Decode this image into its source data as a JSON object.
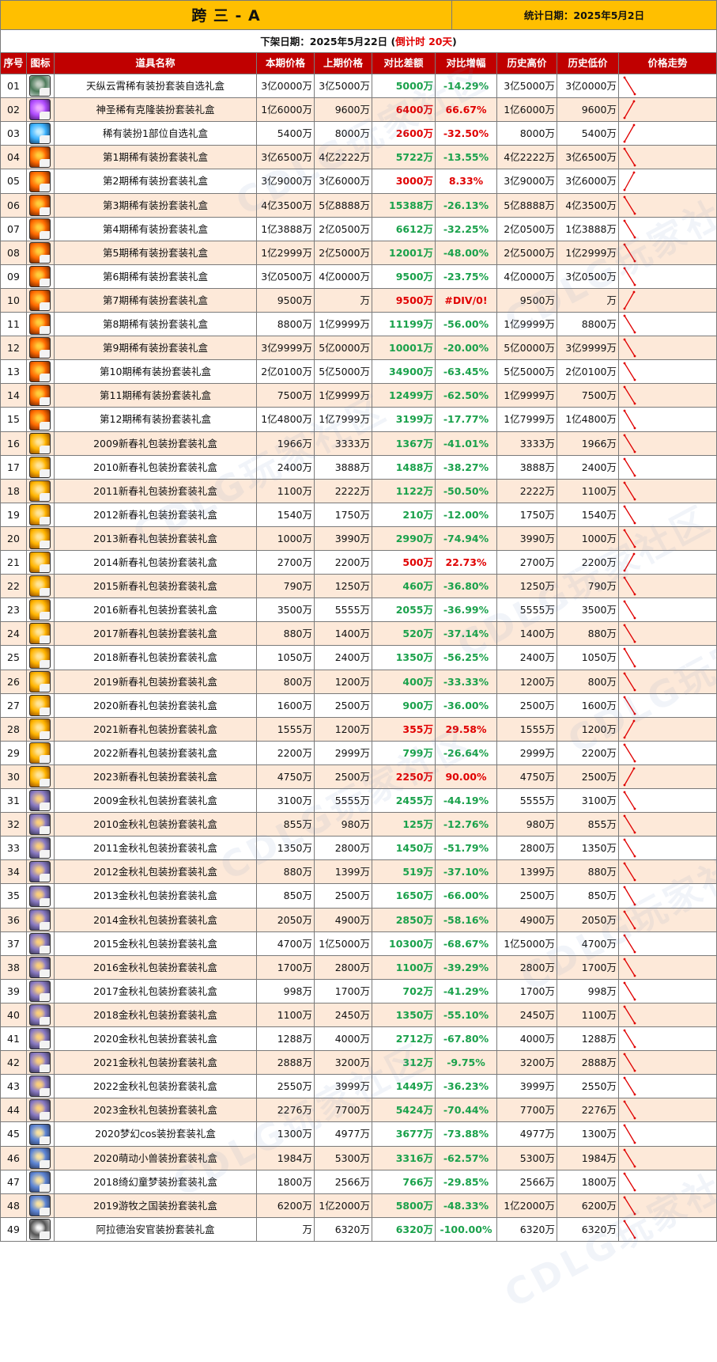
{
  "header": {
    "title": "跨 三 - A",
    "stat_date": "统计日期：2025年5月2日",
    "removal_prefix": "下架日期：2025年5月22日 (",
    "removal_countdown": "倒计时 20天",
    "removal_suffix": ")"
  },
  "columns": [
    "序号",
    "图标",
    "道具名称",
    "本期价格",
    "上期价格",
    "对比差额",
    "对比增幅",
    "历史高价",
    "历史低价",
    "价格走势"
  ],
  "colors": {
    "title_bg": "#ffbf00",
    "header_bg": "#c00000",
    "row_alt_bg": "#fde9d9",
    "increase_red": "#e00000",
    "decrease_green": "#1aa14b",
    "trend_line": "#e00000"
  },
  "watermark": "CDLG玩家社区",
  "rows": [
    {
      "no": "01",
      "name": "天纵云霄稀有装扮套装自选礼盒",
      "cur": "3亿0000万",
      "prev": "3亿5000万",
      "diff": "5000万",
      "pct": "-14.29%",
      "high": "3亿5000万",
      "low": "3亿0000万",
      "dir": "down",
      "icon": "ornate-green"
    },
    {
      "no": "02",
      "name": "神圣稀有克隆装扮套装礼盒",
      "cur": "1亿6000万",
      "prev": "9600万",
      "diff": "6400万",
      "pct": "66.67%",
      "high": "1亿6000万",
      "low": "9600万",
      "dir": "up",
      "icon": "purple-orb"
    },
    {
      "no": "03",
      "name": "稀有装扮1部位自选礼盒",
      "cur": "5400万",
      "prev": "8000万",
      "diff": "2600万",
      "pct": "-32.50%",
      "high": "8000万",
      "low": "5400万",
      "dir": "up",
      "icon": "blue-orb"
    },
    {
      "no": "04",
      "name": "第1期稀有装扮套装礼盒",
      "cur": "3亿6500万",
      "prev": "4亿2222万",
      "diff": "5722万",
      "pct": "-13.55%",
      "high": "4亿2222万",
      "low": "3亿6500万",
      "dir": "down",
      "icon": "fire-box"
    },
    {
      "no": "05",
      "name": "第2期稀有装扮套装礼盒",
      "cur": "3亿9000万",
      "prev": "3亿6000万",
      "diff": "3000万",
      "pct": "8.33%",
      "high": "3亿9000万",
      "low": "3亿6000万",
      "dir": "up",
      "icon": "fire-box"
    },
    {
      "no": "06",
      "name": "第3期稀有装扮套装礼盒",
      "cur": "4亿3500万",
      "prev": "5亿8888万",
      "diff": "15388万",
      "pct": "-26.13%",
      "high": "5亿8888万",
      "low": "4亿3500万",
      "dir": "down",
      "icon": "fire-box"
    },
    {
      "no": "07",
      "name": "第4期稀有装扮套装礼盒",
      "cur": "1亿3888万",
      "prev": "2亿0500万",
      "diff": "6612万",
      "pct": "-32.25%",
      "high": "2亿0500万",
      "low": "1亿3888万",
      "dir": "down",
      "icon": "fire-box"
    },
    {
      "no": "08",
      "name": "第5期稀有装扮套装礼盒",
      "cur": "1亿2999万",
      "prev": "2亿5000万",
      "diff": "12001万",
      "pct": "-48.00%",
      "high": "2亿5000万",
      "low": "1亿2999万",
      "dir": "down",
      "icon": "fire-box"
    },
    {
      "no": "09",
      "name": "第6期稀有装扮套装礼盒",
      "cur": "3亿0500万",
      "prev": "4亿0000万",
      "diff": "9500万",
      "pct": "-23.75%",
      "high": "4亿0000万",
      "low": "3亿0500万",
      "dir": "down",
      "icon": "fire-box"
    },
    {
      "no": "10",
      "name": "第7期稀有装扮套装礼盒",
      "cur": "9500万",
      "prev": "万",
      "diff": "9500万",
      "pct": "#DIV/0!",
      "high": "9500万",
      "low": "万",
      "dir": "up",
      "icon": "fire-box"
    },
    {
      "no": "11",
      "name": "第8期稀有装扮套装礼盒",
      "cur": "8800万",
      "prev": "1亿9999万",
      "diff": "11199万",
      "pct": "-56.00%",
      "high": "1亿9999万",
      "low": "8800万",
      "dir": "down",
      "icon": "fire-box"
    },
    {
      "no": "12",
      "name": "第9期稀有装扮套装礼盒",
      "cur": "3亿9999万",
      "prev": "5亿0000万",
      "diff": "10001万",
      "pct": "-20.00%",
      "high": "5亿0000万",
      "low": "3亿9999万",
      "dir": "down",
      "icon": "fire-box"
    },
    {
      "no": "13",
      "name": "第10期稀有装扮套装礼盒",
      "cur": "2亿0100万",
      "prev": "5亿5000万",
      "diff": "34900万",
      "pct": "-63.45%",
      "high": "5亿5000万",
      "low": "2亿0100万",
      "dir": "down",
      "icon": "fire-box"
    },
    {
      "no": "14",
      "name": "第11期稀有装扮套装礼盒",
      "cur": "7500万",
      "prev": "1亿9999万",
      "diff": "12499万",
      "pct": "-62.50%",
      "high": "1亿9999万",
      "low": "7500万",
      "dir": "down",
      "icon": "fire-box"
    },
    {
      "no": "15",
      "name": "第12期稀有装扮套装礼盒",
      "cur": "1亿4800万",
      "prev": "1亿7999万",
      "diff": "3199万",
      "pct": "-17.77%",
      "high": "1亿7999万",
      "low": "1亿4800万",
      "dir": "down",
      "icon": "fire-box"
    },
    {
      "no": "16",
      "name": "2009新春礼包装扮套装礼盒",
      "cur": "1966万",
      "prev": "3333万",
      "diff": "1367万",
      "pct": "-41.01%",
      "high": "3333万",
      "low": "1966万",
      "dir": "down",
      "icon": "gold-bag"
    },
    {
      "no": "17",
      "name": "2010新春礼包装扮套装礼盒",
      "cur": "2400万",
      "prev": "3888万",
      "diff": "1488万",
      "pct": "-38.27%",
      "high": "3888万",
      "low": "2400万",
      "dir": "down",
      "icon": "gold-bag"
    },
    {
      "no": "18",
      "name": "2011新春礼包装扮套装礼盒",
      "cur": "1100万",
      "prev": "2222万",
      "diff": "1122万",
      "pct": "-50.50%",
      "high": "2222万",
      "low": "1100万",
      "dir": "down",
      "icon": "gold-bag"
    },
    {
      "no": "19",
      "name": "2012新春礼包装扮套装礼盒",
      "cur": "1540万",
      "prev": "1750万",
      "diff": "210万",
      "pct": "-12.00%",
      "high": "1750万",
      "low": "1540万",
      "dir": "down",
      "icon": "gold-bag"
    },
    {
      "no": "20",
      "name": "2013新春礼包装扮套装礼盒",
      "cur": "1000万",
      "prev": "3990万",
      "diff": "2990万",
      "pct": "-74.94%",
      "high": "3990万",
      "low": "1000万",
      "dir": "down",
      "icon": "gold-bag"
    },
    {
      "no": "21",
      "name": "2014新春礼包装扮套装礼盒",
      "cur": "2700万",
      "prev": "2200万",
      "diff": "500万",
      "pct": "22.73%",
      "high": "2700万",
      "low": "2200万",
      "dir": "up",
      "icon": "gold-bag"
    },
    {
      "no": "22",
      "name": "2015新春礼包装扮套装礼盒",
      "cur": "790万",
      "prev": "1250万",
      "diff": "460万",
      "pct": "-36.80%",
      "high": "1250万",
      "low": "790万",
      "dir": "down",
      "icon": "gold-bag"
    },
    {
      "no": "23",
      "name": "2016新春礼包装扮套装礼盒",
      "cur": "3500万",
      "prev": "5555万",
      "diff": "2055万",
      "pct": "-36.99%",
      "high": "5555万",
      "low": "3500万",
      "dir": "down",
      "icon": "gold-bag"
    },
    {
      "no": "24",
      "name": "2017新春礼包装扮套装礼盒",
      "cur": "880万",
      "prev": "1400万",
      "diff": "520万",
      "pct": "-37.14%",
      "high": "1400万",
      "low": "880万",
      "dir": "down",
      "icon": "gold-bag"
    },
    {
      "no": "25",
      "name": "2018新春礼包装扮套装礼盒",
      "cur": "1050万",
      "prev": "2400万",
      "diff": "1350万",
      "pct": "-56.25%",
      "high": "2400万",
      "low": "1050万",
      "dir": "down",
      "icon": "gold-bag"
    },
    {
      "no": "26",
      "name": "2019新春礼包装扮套装礼盒",
      "cur": "800万",
      "prev": "1200万",
      "diff": "400万",
      "pct": "-33.33%",
      "high": "1200万",
      "low": "800万",
      "dir": "down",
      "icon": "gold-bag"
    },
    {
      "no": "27",
      "name": "2020新春礼包装扮套装礼盒",
      "cur": "1600万",
      "prev": "2500万",
      "diff": "900万",
      "pct": "-36.00%",
      "high": "2500万",
      "low": "1600万",
      "dir": "down",
      "icon": "gold-bag"
    },
    {
      "no": "28",
      "name": "2021新春礼包装扮套装礼盒",
      "cur": "1555万",
      "prev": "1200万",
      "diff": "355万",
      "pct": "29.58%",
      "high": "1555万",
      "low": "1200万",
      "dir": "up",
      "icon": "gold-bag"
    },
    {
      "no": "29",
      "name": "2022新春礼包装扮套装礼盒",
      "cur": "2200万",
      "prev": "2999万",
      "diff": "799万",
      "pct": "-26.64%",
      "high": "2999万",
      "low": "2200万",
      "dir": "down",
      "icon": "gold-bag"
    },
    {
      "no": "30",
      "name": "2023新春礼包装扮套装礼盒",
      "cur": "4750万",
      "prev": "2500万",
      "diff": "2250万",
      "pct": "90.00%",
      "high": "4750万",
      "low": "2500万",
      "dir": "up",
      "icon": "gold-bag"
    },
    {
      "no": "31",
      "name": "2009金秋礼包装扮套装礼盒",
      "cur": "3100万",
      "prev": "5555万",
      "diff": "2455万",
      "pct": "-44.19%",
      "high": "5555万",
      "low": "3100万",
      "dir": "down",
      "icon": "autumn-2009"
    },
    {
      "no": "32",
      "name": "2010金秋礼包装扮套装礼盒",
      "cur": "855万",
      "prev": "980万",
      "diff": "125万",
      "pct": "-12.76%",
      "high": "980万",
      "low": "855万",
      "dir": "down",
      "icon": "autumn-2010"
    },
    {
      "no": "33",
      "name": "2011金秋礼包装扮套装礼盒",
      "cur": "1350万",
      "prev": "2800万",
      "diff": "1450万",
      "pct": "-51.79%",
      "high": "2800万",
      "low": "1350万",
      "dir": "down",
      "icon": "autumn-2011"
    },
    {
      "no": "34",
      "name": "2012金秋礼包装扮套装礼盒",
      "cur": "880万",
      "prev": "1399万",
      "diff": "519万",
      "pct": "-37.10%",
      "high": "1399万",
      "low": "880万",
      "dir": "down",
      "icon": "autumn-2012"
    },
    {
      "no": "35",
      "name": "2013金秋礼包装扮套装礼盒",
      "cur": "850万",
      "prev": "2500万",
      "diff": "1650万",
      "pct": "-66.00%",
      "high": "2500万",
      "low": "850万",
      "dir": "down",
      "icon": "autumn-2013"
    },
    {
      "no": "36",
      "name": "2014金秋礼包装扮套装礼盒",
      "cur": "2050万",
      "prev": "4900万",
      "diff": "2850万",
      "pct": "-58.16%",
      "high": "4900万",
      "low": "2050万",
      "dir": "down",
      "icon": "autumn-2014"
    },
    {
      "no": "37",
      "name": "2015金秋礼包装扮套装礼盒",
      "cur": "4700万",
      "prev": "1亿5000万",
      "diff": "10300万",
      "pct": "-68.67%",
      "high": "1亿5000万",
      "low": "4700万",
      "dir": "down",
      "icon": "autumn-2015"
    },
    {
      "no": "38",
      "name": "2016金秋礼包装扮套装礼盒",
      "cur": "1700万",
      "prev": "2800万",
      "diff": "1100万",
      "pct": "-39.29%",
      "high": "2800万",
      "low": "1700万",
      "dir": "down",
      "icon": "autumn-2016"
    },
    {
      "no": "39",
      "name": "2017金秋礼包装扮套装礼盒",
      "cur": "998万",
      "prev": "1700万",
      "diff": "702万",
      "pct": "-41.29%",
      "high": "1700万",
      "low": "998万",
      "dir": "down",
      "icon": "autumn-2017"
    },
    {
      "no": "40",
      "name": "2018金秋礼包装扮套装礼盒",
      "cur": "1100万",
      "prev": "2450万",
      "diff": "1350万",
      "pct": "-55.10%",
      "high": "2450万",
      "low": "1100万",
      "dir": "down",
      "icon": "autumn-2018"
    },
    {
      "no": "41",
      "name": "2020金秋礼包装扮套装礼盒",
      "cur": "1288万",
      "prev": "4000万",
      "diff": "2712万",
      "pct": "-67.80%",
      "high": "4000万",
      "low": "1288万",
      "dir": "down",
      "icon": "autumn-2020"
    },
    {
      "no": "42",
      "name": "2021金秋礼包装扮套装礼盒",
      "cur": "2888万",
      "prev": "3200万",
      "diff": "312万",
      "pct": "-9.75%",
      "high": "3200万",
      "low": "2888万",
      "dir": "down",
      "icon": "autumn-2021"
    },
    {
      "no": "43",
      "name": "2022金秋礼包装扮套装礼盒",
      "cur": "2550万",
      "prev": "3999万",
      "diff": "1449万",
      "pct": "-36.23%",
      "high": "3999万",
      "low": "2550万",
      "dir": "down",
      "icon": "autumn-2022"
    },
    {
      "no": "44",
      "name": "2023金秋礼包装扮套装礼盒",
      "cur": "2276万",
      "prev": "7700万",
      "diff": "5424万",
      "pct": "-70.44%",
      "high": "7700万",
      "low": "2276万",
      "dir": "down",
      "icon": "autumn-2023"
    },
    {
      "no": "45",
      "name": "2020梦幻cos装扮套装礼盒",
      "cur": "1300万",
      "prev": "4977万",
      "diff": "3677万",
      "pct": "-73.88%",
      "high": "4977万",
      "low": "1300万",
      "dir": "down",
      "icon": "dream-2020"
    },
    {
      "no": "46",
      "name": "2020萌动小兽装扮套装礼盒",
      "cur": "1984万",
      "prev": "5300万",
      "diff": "3316万",
      "pct": "-62.57%",
      "high": "5300万",
      "low": "1984万",
      "dir": "down",
      "icon": "beast-2020"
    },
    {
      "no": "47",
      "name": "2018绮幻童梦装扮套装礼盒",
      "cur": "1800万",
      "prev": "2566万",
      "diff": "766万",
      "pct": "-29.85%",
      "high": "2566万",
      "low": "1800万",
      "dir": "down",
      "icon": "child-2018"
    },
    {
      "no": "48",
      "name": "2019游牧之国装扮套装礼盒",
      "cur": "6200万",
      "prev": "1亿2000万",
      "diff": "5800万",
      "pct": "-48.33%",
      "high": "1亿2000万",
      "low": "6200万",
      "dir": "down",
      "icon": "nomad-2019"
    },
    {
      "no": "49",
      "name": "阿拉德治安官装扮套装礼盒",
      "cur": "万",
      "prev": "6320万",
      "diff": "6320万",
      "pct": "-100.00%",
      "high": "6320万",
      "low": "6320万",
      "dir": "down",
      "icon": "sheriff"
    }
  ]
}
